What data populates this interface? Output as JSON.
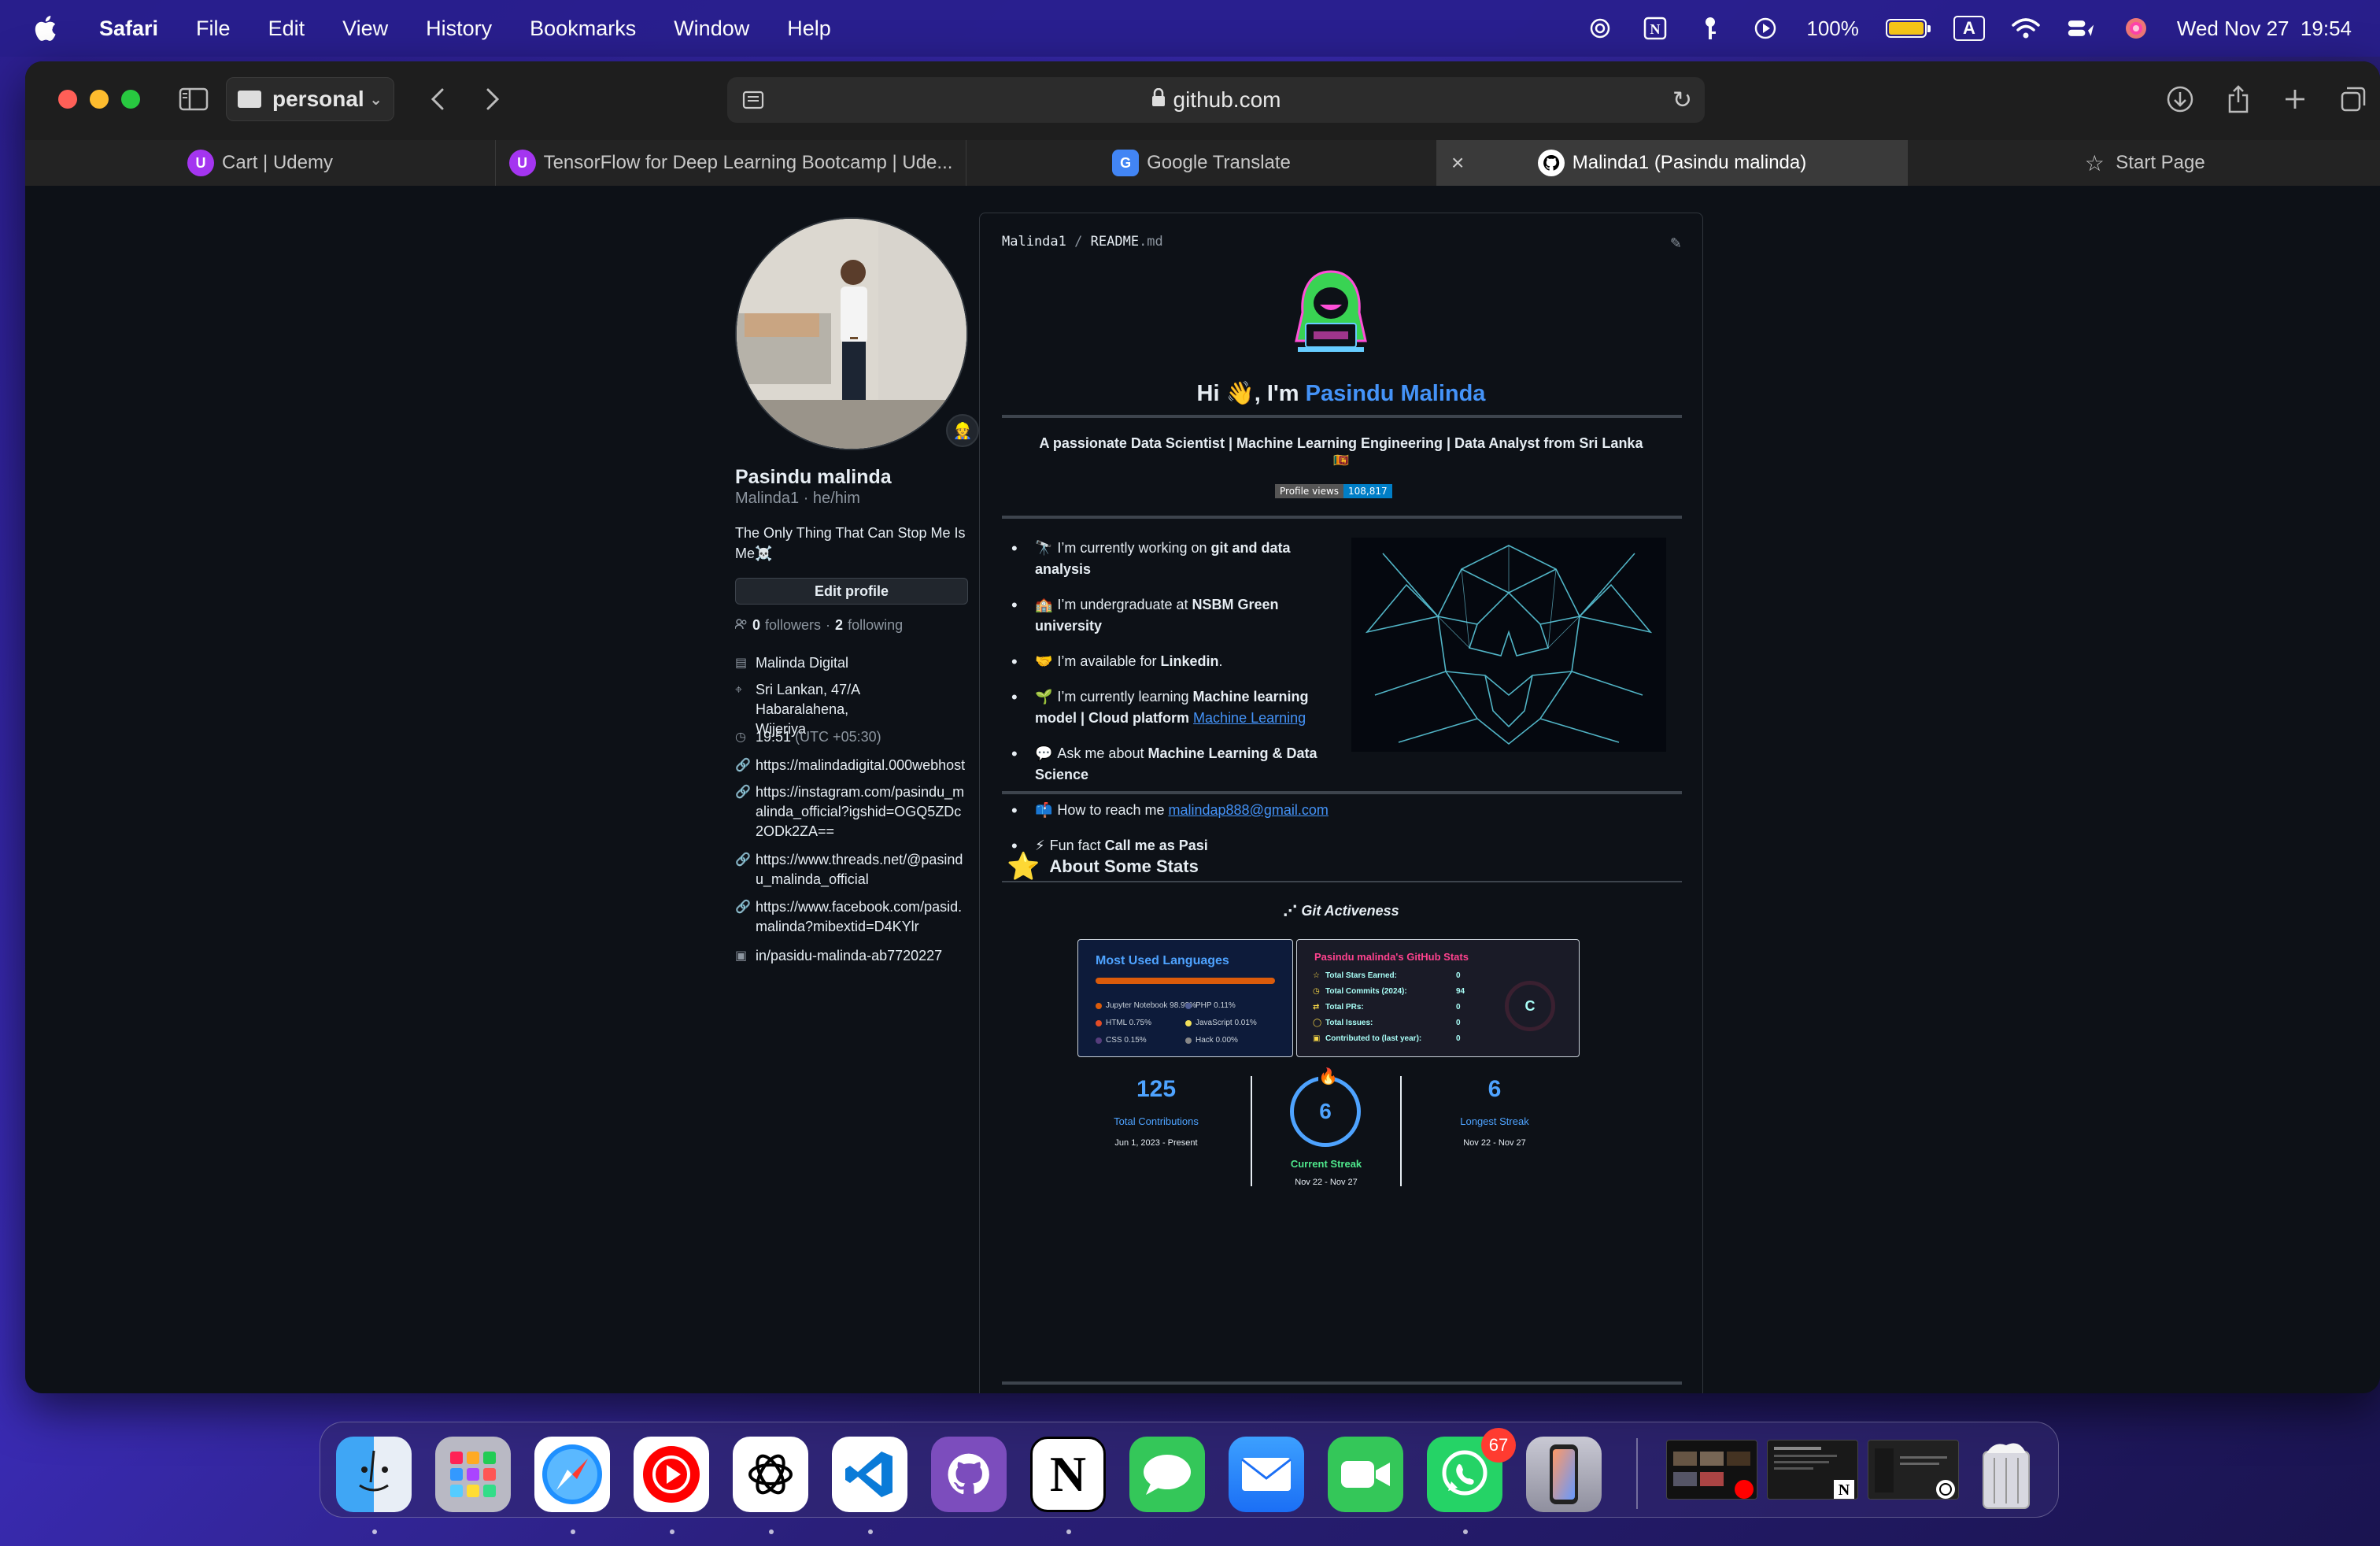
{
  "menubar": {
    "app": "Safari",
    "items": [
      "File",
      "Edit",
      "View",
      "History",
      "Bookmarks",
      "Window",
      "Help"
    ],
    "battery": "100%",
    "input_source": "A",
    "datetime": "Wed Nov 27  19:54"
  },
  "toolbar": {
    "profile": "personal",
    "url": "github.com"
  },
  "tabs": [
    {
      "label": "Cart | Udemy",
      "icon": "udemy-icon",
      "active": false
    },
    {
      "label": "TensorFlow for Deep Learning Bootcamp | Ude...",
      "icon": "udemy-icon",
      "active": false
    },
    {
      "label": "Google Translate",
      "icon": "google-translate-icon",
      "active": false
    },
    {
      "label": "Malinda1 (Pasindu malinda)",
      "icon": "github-icon",
      "active": true
    },
    {
      "label": "Start Page",
      "icon": "star-icon",
      "active": false
    }
  ],
  "profile": {
    "name": "Pasindu malinda",
    "username": "Malinda1 · he/him",
    "bio": "The Only Thing That Can Stop Me Is Me☠️",
    "edit_label": "Edit profile",
    "followers_count": "0",
    "followers_label": "followers",
    "following_count": "2",
    "following_label": "following",
    "company": "Malinda Digital",
    "location": "Sri Lankan, 47/A Habaralahena, Wijeriya",
    "time": "19:51",
    "timezone": "(UTC +05:30)",
    "links": [
      "https://malindadigital.000webhost",
      "https://instagram.com/pasindu_malinda_official?igshid=OGQ5ZDc2ODk2ZA==",
      "https://www.threads.net/@pasindu_malinda_official",
      "https://www.facebook.com/pasid.malinda?mibextid=D4KYlr"
    ],
    "linkedin": "in/pasidu-malinda-ab7720227"
  },
  "readme": {
    "path_user": "Malinda1",
    "path_sep": "/",
    "path_file": "README",
    "path_ext": ".md",
    "hi_prefix": "Hi 👋, I'm ",
    "hi_name": "Pasindu Malinda",
    "tagline": "A passionate Data Scientist | Machine Learning Engineering | Data Analyst from Sri Lanka",
    "flag": "🇱🇰",
    "views_label": "Profile views",
    "views_value": "108,817",
    "bullets": [
      {
        "emoji": "🔭",
        "pre": "I’m currently working on ",
        "bold": "git and data analysis",
        "post": "",
        "link": ""
      },
      {
        "emoji": "🏫",
        "pre": "I’m undergraduate at ",
        "bold": "NSBM Green university",
        "post": "",
        "link": ""
      },
      {
        "emoji": "🤝",
        "pre": "I’m available for ",
        "bold": "Linkedin",
        "post": ".",
        "link": ""
      },
      {
        "emoji": "🌱",
        "pre": "I’m currently learning ",
        "bold": "Machine learning model | Cloud platform",
        "post": " ",
        "link": "Machine Learning"
      },
      {
        "emoji": "💬",
        "pre": "Ask me about ",
        "bold": "Machine Learning & Data Science",
        "post": "",
        "link": ""
      },
      {
        "emoji": "📫",
        "pre": "How to reach me ",
        "bold": "",
        "post": "",
        "link": "malindap888@gmail.com"
      },
      {
        "emoji": "⚡",
        "pre": "Fun fact ",
        "bold": "Call me as Pasi",
        "post": "",
        "link": ""
      }
    ],
    "stats_heading": "About Some Stats",
    "git_activeness": "Git Activeness",
    "languages_card": {
      "title": "Most Used Languages",
      "items": [
        {
          "name": "Jupyter Notebook 98.98%",
          "color": "#da5b0b"
        },
        {
          "name": "PHP 0.11%",
          "color": "#4f5d95"
        },
        {
          "name": "HTML 0.75%",
          "color": "#e34c26"
        },
        {
          "name": "JavaScript 0.01%",
          "color": "#f1e05a"
        },
        {
          "name": "CSS 0.15%",
          "color": "#563d7c"
        },
        {
          "name": "Hack 0.00%",
          "color": "#878787"
        }
      ]
    },
    "github_card": {
      "title": "Pasindu malinda's GitHub Stats",
      "rows": [
        {
          "label": "Total Stars Earned:",
          "value": "0"
        },
        {
          "label": "Total Commits (2024):",
          "value": "94"
        },
        {
          "label": "Total PRs:",
          "value": "0"
        },
        {
          "label": "Total Issues:",
          "value": "0"
        },
        {
          "label": "Contributed to (last year):",
          "value": "0"
        }
      ],
      "rank": "C"
    },
    "streak": {
      "total": "125",
      "total_label": "Total Contributions",
      "total_range": "Jun 1, 2023 - Present",
      "current": "6",
      "current_label": "Current Streak",
      "current_range": "Nov 22 - Nov 27",
      "longest": "6",
      "longest_label": "Longest Streak",
      "longest_range": "Nov 22 - Nov 27"
    }
  },
  "dock": {
    "apps": [
      "Finder",
      "Launchpad",
      "Safari",
      "YouTube Music",
      "ChatGPT",
      "Visual Studio Code",
      "GitHub Desktop",
      "Notion",
      "Messages",
      "Mail",
      "FaceTime",
      "WhatsApp",
      "iPhone Mirroring"
    ],
    "whatsapp_badge": "67"
  },
  "colors": {
    "accent": "#4493f8",
    "bg": "#0d1117"
  }
}
